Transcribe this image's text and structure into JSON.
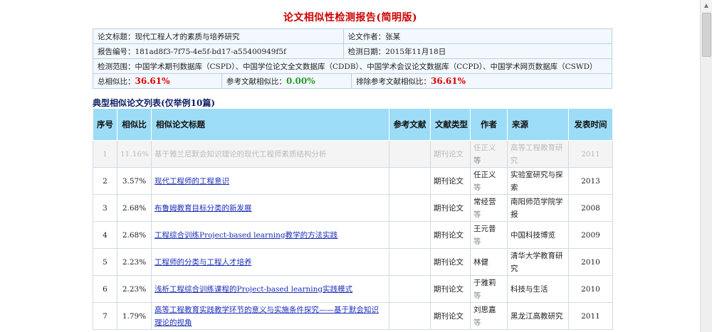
{
  "report_title": "论文相似性检测报告(简明版)",
  "info": {
    "paper_title_label": "论文标题：",
    "paper_title_value": "现代工程人才的素质与培养研究",
    "author_label": "论文作者：",
    "author_value": "张某",
    "report_no_label": "报告编号：",
    "report_no_value": "181ad8f3-7f75-4e5f-bd17-a55400949f5f",
    "date_label": "检测日期：",
    "date_value": "2015年11月18日",
    "scope_label": "检测范围：",
    "scope_value": "中国学术期刊数据库（CSPD）、中国学位论文全文数据库（CDDB）、中国学术会议论文数据库（CCPD）、中国学术网页数据库（CSWD）",
    "total_label": "总相似比：",
    "total_value": "36.61%",
    "ref_label": "参考文献相似比：",
    "ref_value": "0.00%",
    "excl_label": "排除参考文献相似比：",
    "excl_value": "36.61%"
  },
  "section_title": "典型相似论文列表(仅举例10篇)",
  "columns": {
    "no": "序号",
    "ratio": "相似比",
    "title": "相似论文标题",
    "ref": "参考文献",
    "type": "文献类型",
    "author": "作者",
    "source": "来源",
    "time": "发表时间"
  },
  "rows": [
    {
      "no": "1",
      "ratio": "11.16%",
      "title": "基于雅兰尼默会知识理论的现代工程师素质结构分析",
      "ref": "",
      "type": "期刊论文",
      "author": "任正义",
      "etal": "等",
      "source": "高等工程教育研究",
      "time": "2011",
      "dim": true
    },
    {
      "no": "2",
      "ratio": "3.57%",
      "title": "现代工程师的工程意识",
      "ref": "",
      "type": "期刊论文",
      "author": "任正义",
      "etal": "等",
      "source": "实验室研究与探索",
      "time": "2013",
      "dim": false
    },
    {
      "no": "3",
      "ratio": "2.68%",
      "title": "布鲁姆教育目标分类的新发展",
      "ref": "",
      "type": "期刊论文",
      "author": "常经营",
      "etal": "等",
      "source": "南阳师范学院学报",
      "time": "2008",
      "dim": false
    },
    {
      "no": "4",
      "ratio": "2.68%",
      "title": "工程综合训练Project-based learning教学的方法实践",
      "ref": "",
      "type": "期刊论文",
      "author": "王元普",
      "etal": "等",
      "source": "中国科技博览",
      "time": "2009",
      "dim": false
    },
    {
      "no": "5",
      "ratio": "2.23%",
      "title": "工程师的分类与工程人才培养",
      "ref": "",
      "type": "期刊论文",
      "author": "林健",
      "etal": "",
      "source": "清华大学教育研究",
      "time": "2010",
      "dim": false
    },
    {
      "no": "6",
      "ratio": "2.23%",
      "title": "浅析工程综合训练课程的Project-based learning实践模式",
      "ref": "",
      "type": "期刊论文",
      "author": "于雅莉",
      "etal": "等",
      "source": "科技与生活",
      "time": "2010",
      "dim": false
    },
    {
      "no": "7",
      "ratio": "1.79%",
      "title": "高等工程教育实践教学环节的意义与实施条件探究——基于默会知识理论的视角",
      "ref": "",
      "type": "期刊论文",
      "author": "刘思嘉",
      "etal": "等",
      "source": "黑龙江高教研究",
      "time": "2011",
      "dim": false
    }
  ]
}
